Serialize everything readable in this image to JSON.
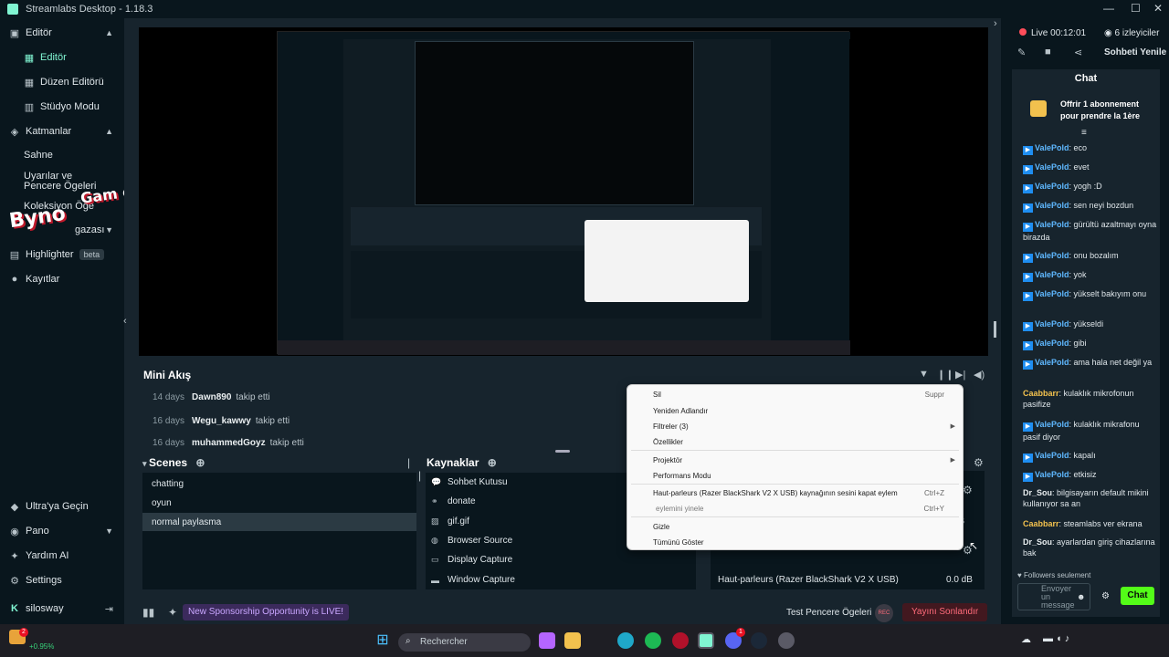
{
  "window": {
    "title": "Streamlabs Desktop - 1.18.3"
  },
  "sidebar": {
    "items": [
      {
        "label": "Editör"
      },
      {
        "label": "Editör"
      },
      {
        "label": "Düzen Editörü"
      },
      {
        "label": "Stüdyo Modu"
      },
      {
        "label": "Katmanlar"
      },
      {
        "label": "Sahne"
      },
      {
        "label": "Uyarılar ve Pencere Ögeleri"
      },
      {
        "label": "Koleksiyon Öğe"
      },
      {
        "label": "gazası"
      },
      {
        "label": "Highlighter"
      },
      {
        "label": "Kayıtlar"
      }
    ],
    "beta_label": "beta",
    "bottom": [
      {
        "label": "Ultra'ya Geçin"
      },
      {
        "label": "Pano"
      },
      {
        "label": "Yardım AI"
      },
      {
        "label": "Settings"
      },
      {
        "label": "silosway"
      }
    ]
  },
  "watermark": {
    "text1": "Byno",
    "text2": "Gam e"
  },
  "mini_feed": {
    "title": "Mini Akış",
    "rows": [
      {
        "time": "14 days",
        "user": "Dawn890",
        "action": "takip etti"
      },
      {
        "time": "16 days",
        "user": "Wegu_kawwy",
        "action": "takip etti"
      },
      {
        "time": "16 days",
        "user": "muhammedGoyz",
        "action": "takip etti"
      }
    ]
  },
  "scenes": {
    "title": "Scenes",
    "items": [
      "chatting",
      "oyun",
      "normal paylasma"
    ],
    "selected": 2
  },
  "sources": {
    "title": "Kaynaklar",
    "items": [
      "Sohbet Kutusu",
      "donate",
      "gif.gif",
      "Browser Source",
      "Display Capture",
      "Window Capture"
    ]
  },
  "mixer": {
    "db1": "0.0 dB",
    "db2": "dB",
    "device": "Haut-parleurs (Razer BlackShark V2 X USB)",
    "device_db": "0.0 dB"
  },
  "context_menu": {
    "items": [
      {
        "label": "Sil",
        "shortcut": "Suppr"
      },
      {
        "label": "Yeniden Adlandır"
      },
      {
        "label": "Filtreler (3)"
      },
      {
        "label": "Özellikler"
      },
      {
        "label": "Projektör"
      },
      {
        "label": "Performans Modu"
      },
      {
        "label": "Haut-parleurs (Razer BlackShark V2 X USB) kaynağının sesini kapat eylemini geri al",
        "shortcut": "Ctrl+Z"
      },
      {
        "label": "eylemini yinele",
        "shortcut": "Ctrl+Y"
      },
      {
        "label": "Gizle"
      },
      {
        "label": "Tümünü Göster"
      }
    ]
  },
  "status_bar": {
    "sponsor": "New Sponsorship Opportunity is LIVE!",
    "test_label": "Test Pencere Ögeleri",
    "rec_label": "REC",
    "end_label": "Yayını Sonlandır"
  },
  "chat": {
    "live_label": "Live",
    "live_time": "00:12:01",
    "viewers": "6 izleyiciler",
    "refresh": "Sohbeti Yenile",
    "title": "Chat",
    "pinned": "Offrir 1 abonnement pour prendre la 1ère",
    "messages": [
      {
        "user": "ValePold",
        "text": "eco",
        "badge": true
      },
      {
        "user": "ValePold",
        "text": "evet",
        "badge": true
      },
      {
        "user": "ValePold",
        "text": "yogh :D",
        "badge": true
      },
      {
        "user": "ValePold",
        "text": "sen neyi bozdun",
        "badge": true
      },
      {
        "user": "ValePold",
        "text": "gürültü azaltmayı oyna birazda",
        "badge": true
      },
      {
        "user": "ValePold",
        "text": "onu bozalım",
        "badge": true
      },
      {
        "user": "ValePold",
        "text": "yok",
        "badge": true
      },
      {
        "user": "ValePold",
        "text": "yükselt bakıyım onu",
        "badge": true
      },
      {
        "user": "ValePold",
        "text": "yükseldi",
        "badge": true
      },
      {
        "user": "ValePold",
        "text": "gibi",
        "badge": true
      },
      {
        "user": "ValePold",
        "text": "ama hala net değil ya",
        "badge": true
      },
      {
        "user": "Caabbarr",
        "text": "kulaklık mikrofonun pasifize",
        "badge": false
      },
      {
        "user": "ValePold",
        "text": "kulaklık mikrafonu pasif diyor",
        "badge": true
      },
      {
        "user": "ValePold",
        "text": "kapalı",
        "badge": true
      },
      {
        "user": "ValePold",
        "text": "etkisiz",
        "badge": true
      },
      {
        "user": "Dr_Sou",
        "text": "bilgisayarın default mikini kullanıyor sa an",
        "badge": false
      },
      {
        "user": "Caabbarr",
        "text": "steamlabs ver ekrana",
        "badge": false
      },
      {
        "user": "Dr_Sou",
        "text": "ayarlardan giriş cihazlarına bak",
        "badge": false
      }
    ],
    "followers_only": "Followers seulement",
    "input_placeholder": "Envoyer un message",
    "send_label": "Chat",
    "colors": {
      "ValePold": "#5fb8ff",
      "Caabbarr": "#f2c14e",
      "Dr_Sou": "#e9eef0"
    }
  },
  "taskbar": {
    "search_placeholder": "Rechercher",
    "stock_value": "+0.95%",
    "badge_count": "2",
    "discord_count": "1"
  }
}
